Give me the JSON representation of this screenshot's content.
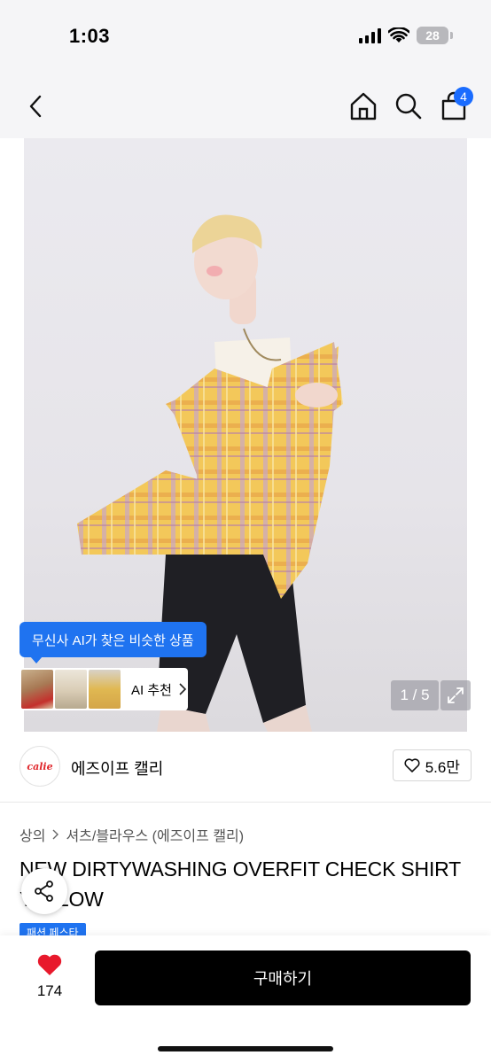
{
  "status_bar": {
    "time": "1:03",
    "battery": "28"
  },
  "nav": {
    "cart_count": "4"
  },
  "gallery": {
    "counter": "1 / 5",
    "ai_tooltip": "무신사 AI가 찾은 비슷한 상품",
    "ai_recommend_label": "AI 추천"
  },
  "brand": {
    "logo_text": "calie",
    "name": "에즈이프 캘리",
    "likes": "5.6만"
  },
  "product": {
    "category": "상의",
    "subcategory": "셔츠/블라우스 (에즈이프 캘리)",
    "title": "NEW DIRTYWASHING OVERFIT CHECK SHIRT YELLOW",
    "badge": "패션 페스타"
  },
  "bottom_bar": {
    "wish_count": "174",
    "buy_label": "구매하기"
  },
  "colors": {
    "accent": "#1f73f0",
    "wish_red": "#e8192c",
    "buy_button": "#000000"
  }
}
